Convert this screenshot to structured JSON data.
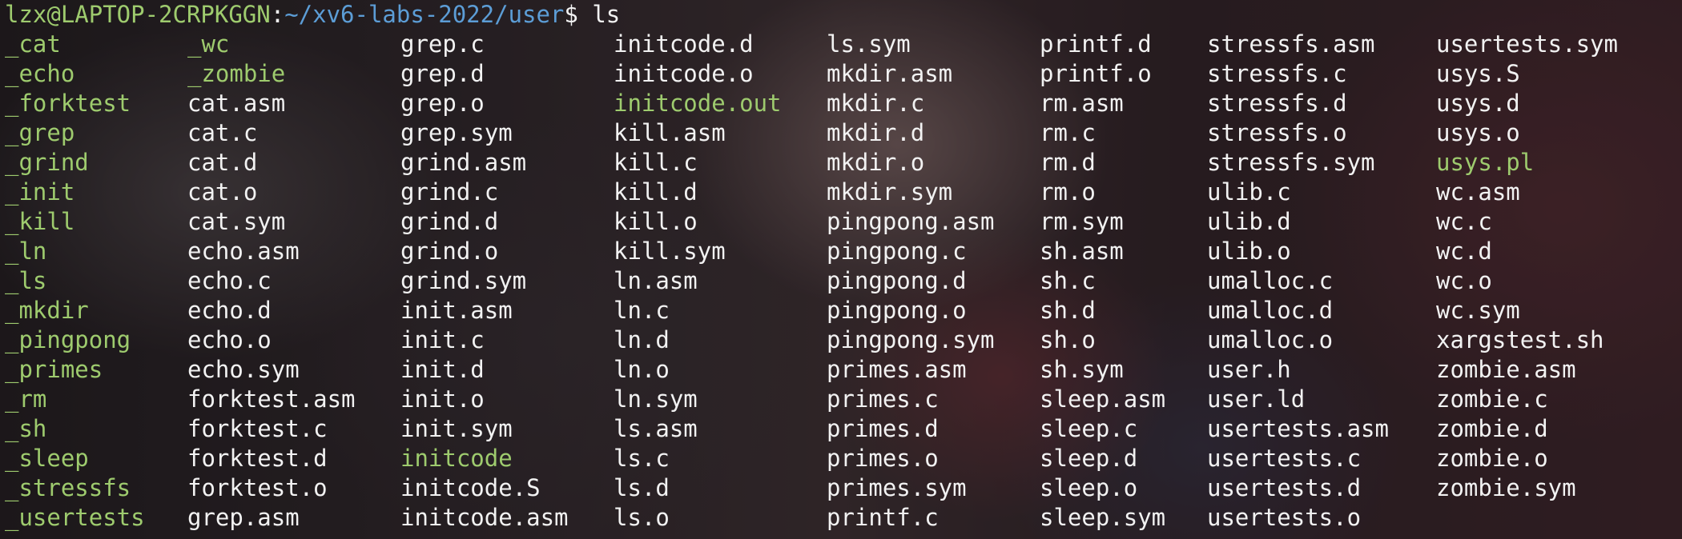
{
  "prompt": {
    "user_host": "lzx@LAPTOP-2CRPKGGN",
    "colon": ":",
    "path": "~/xv6-labs-2022/user",
    "symbol": "$",
    "command": "ls"
  },
  "listing": {
    "executable_color": "#9ecb6e",
    "regular_color": "#f2f2f2",
    "columns": [
      [
        {
          "name": "_cat",
          "exec": true
        },
        {
          "name": "_echo",
          "exec": true
        },
        {
          "name": "_forktest",
          "exec": true
        },
        {
          "name": "_grep",
          "exec": true
        },
        {
          "name": "_grind",
          "exec": true
        },
        {
          "name": "_init",
          "exec": true
        },
        {
          "name": "_kill",
          "exec": true
        },
        {
          "name": "_ln",
          "exec": true
        },
        {
          "name": "_ls",
          "exec": true
        },
        {
          "name": "_mkdir",
          "exec": true
        },
        {
          "name": "_pingpong",
          "exec": true
        },
        {
          "name": "_primes",
          "exec": true
        },
        {
          "name": "_rm",
          "exec": true
        },
        {
          "name": "_sh",
          "exec": true
        },
        {
          "name": "_sleep",
          "exec": true
        },
        {
          "name": "_stressfs",
          "exec": true
        },
        {
          "name": "_usertests",
          "exec": true
        }
      ],
      [
        {
          "name": "_wc",
          "exec": true
        },
        {
          "name": "_zombie",
          "exec": true
        },
        {
          "name": "cat.asm",
          "exec": false
        },
        {
          "name": "cat.c",
          "exec": false
        },
        {
          "name": "cat.d",
          "exec": false
        },
        {
          "name": "cat.o",
          "exec": false
        },
        {
          "name": "cat.sym",
          "exec": false
        },
        {
          "name": "echo.asm",
          "exec": false
        },
        {
          "name": "echo.c",
          "exec": false
        },
        {
          "name": "echo.d",
          "exec": false
        },
        {
          "name": "echo.o",
          "exec": false
        },
        {
          "name": "echo.sym",
          "exec": false
        },
        {
          "name": "forktest.asm",
          "exec": false
        },
        {
          "name": "forktest.c",
          "exec": false
        },
        {
          "name": "forktest.d",
          "exec": false
        },
        {
          "name": "forktest.o",
          "exec": false
        },
        {
          "name": "grep.asm",
          "exec": false
        }
      ],
      [
        {
          "name": "grep.c",
          "exec": false
        },
        {
          "name": "grep.d",
          "exec": false
        },
        {
          "name": "grep.o",
          "exec": false
        },
        {
          "name": "grep.sym",
          "exec": false
        },
        {
          "name": "grind.asm",
          "exec": false
        },
        {
          "name": "grind.c",
          "exec": false
        },
        {
          "name": "grind.d",
          "exec": false
        },
        {
          "name": "grind.o",
          "exec": false
        },
        {
          "name": "grind.sym",
          "exec": false
        },
        {
          "name": "init.asm",
          "exec": false
        },
        {
          "name": "init.c",
          "exec": false
        },
        {
          "name": "init.d",
          "exec": false
        },
        {
          "name": "init.o",
          "exec": false
        },
        {
          "name": "init.sym",
          "exec": false
        },
        {
          "name": "initcode",
          "exec": true
        },
        {
          "name": "initcode.S",
          "exec": false
        },
        {
          "name": "initcode.asm",
          "exec": false
        }
      ],
      [
        {
          "name": "initcode.d",
          "exec": false
        },
        {
          "name": "initcode.o",
          "exec": false
        },
        {
          "name": "initcode.out",
          "exec": true
        },
        {
          "name": "kill.asm",
          "exec": false
        },
        {
          "name": "kill.c",
          "exec": false
        },
        {
          "name": "kill.d",
          "exec": false
        },
        {
          "name": "kill.o",
          "exec": false
        },
        {
          "name": "kill.sym",
          "exec": false
        },
        {
          "name": "ln.asm",
          "exec": false
        },
        {
          "name": "ln.c",
          "exec": false
        },
        {
          "name": "ln.d",
          "exec": false
        },
        {
          "name": "ln.o",
          "exec": false
        },
        {
          "name": "ln.sym",
          "exec": false
        },
        {
          "name": "ls.asm",
          "exec": false
        },
        {
          "name": "ls.c",
          "exec": false
        },
        {
          "name": "ls.d",
          "exec": false
        },
        {
          "name": "ls.o",
          "exec": false
        }
      ],
      [
        {
          "name": "ls.sym",
          "exec": false
        },
        {
          "name": "mkdir.asm",
          "exec": false
        },
        {
          "name": "mkdir.c",
          "exec": false
        },
        {
          "name": "mkdir.d",
          "exec": false
        },
        {
          "name": "mkdir.o",
          "exec": false
        },
        {
          "name": "mkdir.sym",
          "exec": false
        },
        {
          "name": "pingpong.asm",
          "exec": false
        },
        {
          "name": "pingpong.c",
          "exec": false
        },
        {
          "name": "pingpong.d",
          "exec": false
        },
        {
          "name": "pingpong.o",
          "exec": false
        },
        {
          "name": "pingpong.sym",
          "exec": false
        },
        {
          "name": "primes.asm",
          "exec": false
        },
        {
          "name": "primes.c",
          "exec": false
        },
        {
          "name": "primes.d",
          "exec": false
        },
        {
          "name": "primes.o",
          "exec": false
        },
        {
          "name": "primes.sym",
          "exec": false
        },
        {
          "name": "printf.c",
          "exec": false
        }
      ],
      [
        {
          "name": "printf.d",
          "exec": false
        },
        {
          "name": "printf.o",
          "exec": false
        },
        {
          "name": "rm.asm",
          "exec": false
        },
        {
          "name": "rm.c",
          "exec": false
        },
        {
          "name": "rm.d",
          "exec": false
        },
        {
          "name": "rm.o",
          "exec": false
        },
        {
          "name": "rm.sym",
          "exec": false
        },
        {
          "name": "sh.asm",
          "exec": false
        },
        {
          "name": "sh.c",
          "exec": false
        },
        {
          "name": "sh.d",
          "exec": false
        },
        {
          "name": "sh.o",
          "exec": false
        },
        {
          "name": "sh.sym",
          "exec": false
        },
        {
          "name": "sleep.asm",
          "exec": false
        },
        {
          "name": "sleep.c",
          "exec": false
        },
        {
          "name": "sleep.d",
          "exec": false
        },
        {
          "name": "sleep.o",
          "exec": false
        },
        {
          "name": "sleep.sym",
          "exec": false
        }
      ],
      [
        {
          "name": "stressfs.asm",
          "exec": false
        },
        {
          "name": "stressfs.c",
          "exec": false
        },
        {
          "name": "stressfs.d",
          "exec": false
        },
        {
          "name": "stressfs.o",
          "exec": false
        },
        {
          "name": "stressfs.sym",
          "exec": false
        },
        {
          "name": "ulib.c",
          "exec": false
        },
        {
          "name": "ulib.d",
          "exec": false
        },
        {
          "name": "ulib.o",
          "exec": false
        },
        {
          "name": "umalloc.c",
          "exec": false
        },
        {
          "name": "umalloc.d",
          "exec": false
        },
        {
          "name": "umalloc.o",
          "exec": false
        },
        {
          "name": "user.h",
          "exec": false
        },
        {
          "name": "user.ld",
          "exec": false
        },
        {
          "name": "usertests.asm",
          "exec": false
        },
        {
          "name": "usertests.c",
          "exec": false
        },
        {
          "name": "usertests.d",
          "exec": false
        },
        {
          "name": "usertests.o",
          "exec": false
        }
      ],
      [
        {
          "name": "usertests.sym",
          "exec": false
        },
        {
          "name": "usys.S",
          "exec": false
        },
        {
          "name": "usys.d",
          "exec": false
        },
        {
          "name": "usys.o",
          "exec": false
        },
        {
          "name": "usys.pl",
          "exec": true
        },
        {
          "name": "wc.asm",
          "exec": false
        },
        {
          "name": "wc.c",
          "exec": false
        },
        {
          "name": "wc.d",
          "exec": false
        },
        {
          "name": "wc.o",
          "exec": false
        },
        {
          "name": "wc.sym",
          "exec": false
        },
        {
          "name": "xargstest.sh",
          "exec": false
        },
        {
          "name": "zombie.asm",
          "exec": false
        },
        {
          "name": "zombie.c",
          "exec": false
        },
        {
          "name": "zombie.d",
          "exec": false
        },
        {
          "name": "zombie.o",
          "exec": false
        },
        {
          "name": "zombie.sym",
          "exec": false
        }
      ]
    ]
  }
}
